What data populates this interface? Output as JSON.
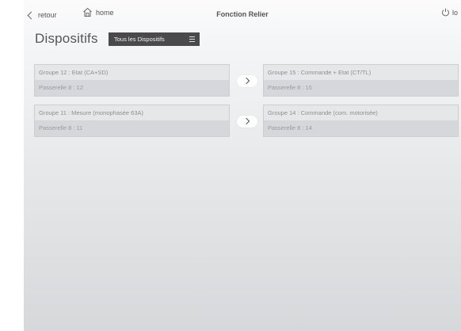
{
  "topbar": {
    "back_label": "retour",
    "home_label": "home",
    "title": "Fonction Relier",
    "logout_label": "lo"
  },
  "header": {
    "title": "Dispositifs",
    "filter_selected": "Tous les Dispositifs"
  },
  "links": [
    {
      "source": {
        "title": "Groupe 12 : Etat (CA+SD)",
        "subtitle": "Passerelle 8 : 12"
      },
      "target": {
        "title": "Groupe 15 : Commande + Etat (CT/TL)",
        "subtitle": "Passerelle 8 : 15"
      }
    },
    {
      "source": {
        "title": "Groupe 11 : Mesure (monophasée 63A)",
        "subtitle": "Passerelle 8 : 11"
      },
      "target": {
        "title": "Groupe 14 : Commande (com. motorisée)",
        "subtitle": "Passerelle 8 : 14"
      }
    }
  ],
  "icons": {
    "back": "chevron-left-icon",
    "home": "home-icon",
    "logout": "power-icon",
    "filter": "menu-icon",
    "link": "chevron-right-icon"
  }
}
